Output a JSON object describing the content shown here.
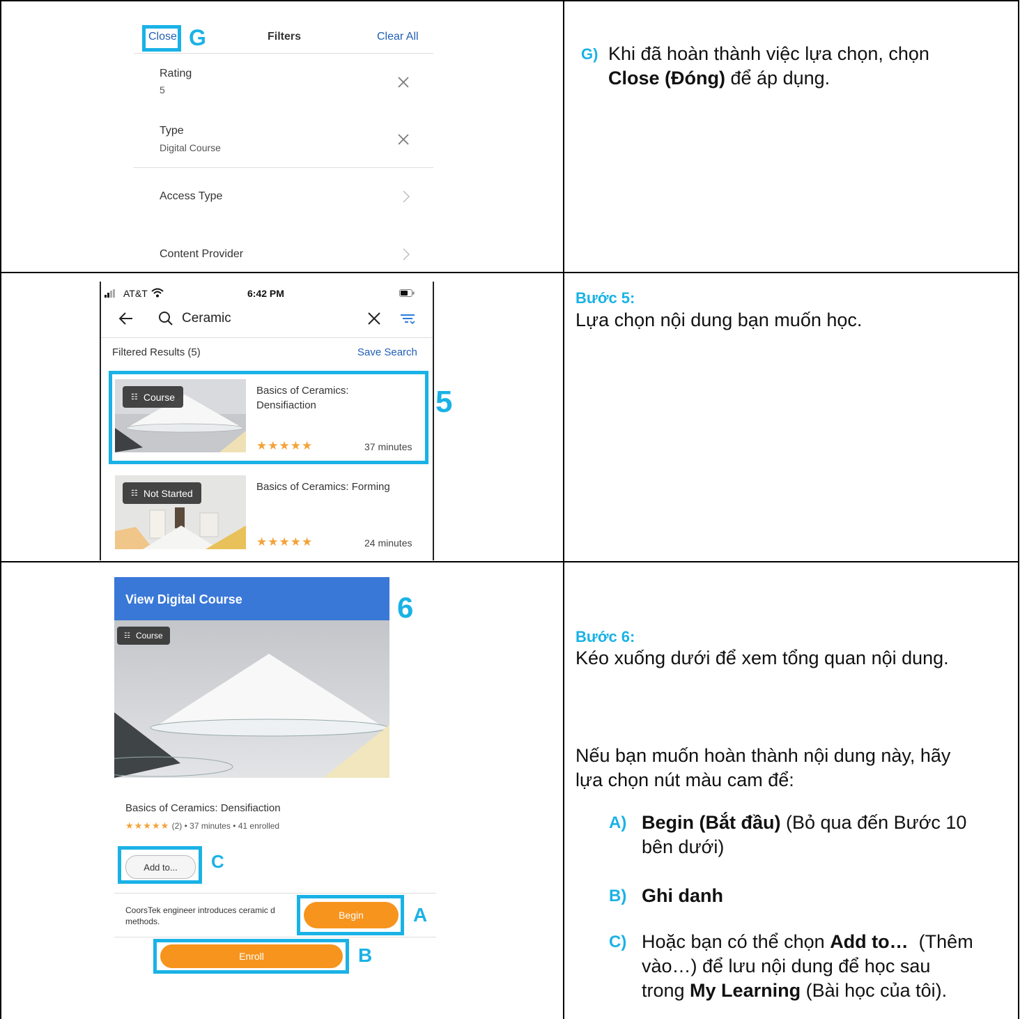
{
  "filters": {
    "close_label": "Close",
    "marker": "G",
    "title": "Filters",
    "clear_all": "Clear All",
    "items": [
      {
        "label": "Rating",
        "value": "5"
      },
      {
        "label": "Type",
        "value": "Digital Course"
      },
      {
        "label": "Access Type",
        "value": ""
      },
      {
        "label": "Content Provider",
        "value": ""
      }
    ]
  },
  "row1_text": {
    "letter": "G)",
    "line1": "Khi đã hoàn thành việc lựa chọn, chọn",
    "bold": "Close (Đóng)",
    "line2_rest": " để áp dụng."
  },
  "search_screen": {
    "carrier": "AT&T",
    "time": "6:42 PM",
    "query": "Ceramic",
    "filtered_results": "Filtered Results (5)",
    "save_search": "Save Search",
    "marker": "5",
    "results": [
      {
        "tag": "Course",
        "title_line1": "Basics of Ceramics:",
        "title_line2": "Densifiaction",
        "stars": "★★★★★",
        "duration": "37 minutes"
      },
      {
        "tag": "Not Started",
        "title_line1": "Basics of Ceramics: Forming",
        "title_line2": "",
        "stars": "★★★★★",
        "duration": "24 minutes"
      }
    ]
  },
  "row2_text": {
    "heading": "Bước 5:",
    "body": "Lựa chọn nội dung bạn muốn học."
  },
  "course_screen": {
    "header": "View Digital Course",
    "marker": "6",
    "tag": "Course",
    "title": "Basics of Ceramics: Densifiaction",
    "stars": "★★★★★",
    "meta": "(2)  •  37 minutes  •  41 enrolled",
    "add_to": "Add to...",
    "marker_c": "C",
    "description_line1": "CoorsTek engineer introduces ceramic d",
    "description_line2": "methods.",
    "begin": "Begin",
    "marker_a": "A",
    "enroll": "Enroll",
    "marker_b": "B"
  },
  "row3_text": {
    "heading": "Bước 6:",
    "body1": "Kéo xuống dưới để xem tổng quan nội dung.",
    "body2_line1": "Nếu bạn muốn hoàn thành nội dung này, hãy",
    "body2_line2": "lựa chọn nút màu cam để:",
    "a_letter": "A)",
    "a_bold": "Begin (Bắt đầu)",
    "a_rest": " (Bỏ qua đến Bước 10",
    "a_line2": "bên dưới)",
    "b_letter": "B)",
    "b_bold": "Ghi danh",
    "c_letter": "C)",
    "c_pre": "Hoặc bạn có thể chọn ",
    "c_bold": "Add to…",
    "c_rest": "  (Thêm",
    "c_line2": "vào…) để lưu nội dung để học sau",
    "c_line3_pre": "trong ",
    "c_line3_bold": "My Learning",
    "c_line3_rest": " (Bài học của tôi)."
  },
  "colors": {
    "accent": "#1ab2e6",
    "orange": "#f7941d",
    "header_blue": "#3a78d8",
    "link_blue": "#1f5fb4"
  }
}
